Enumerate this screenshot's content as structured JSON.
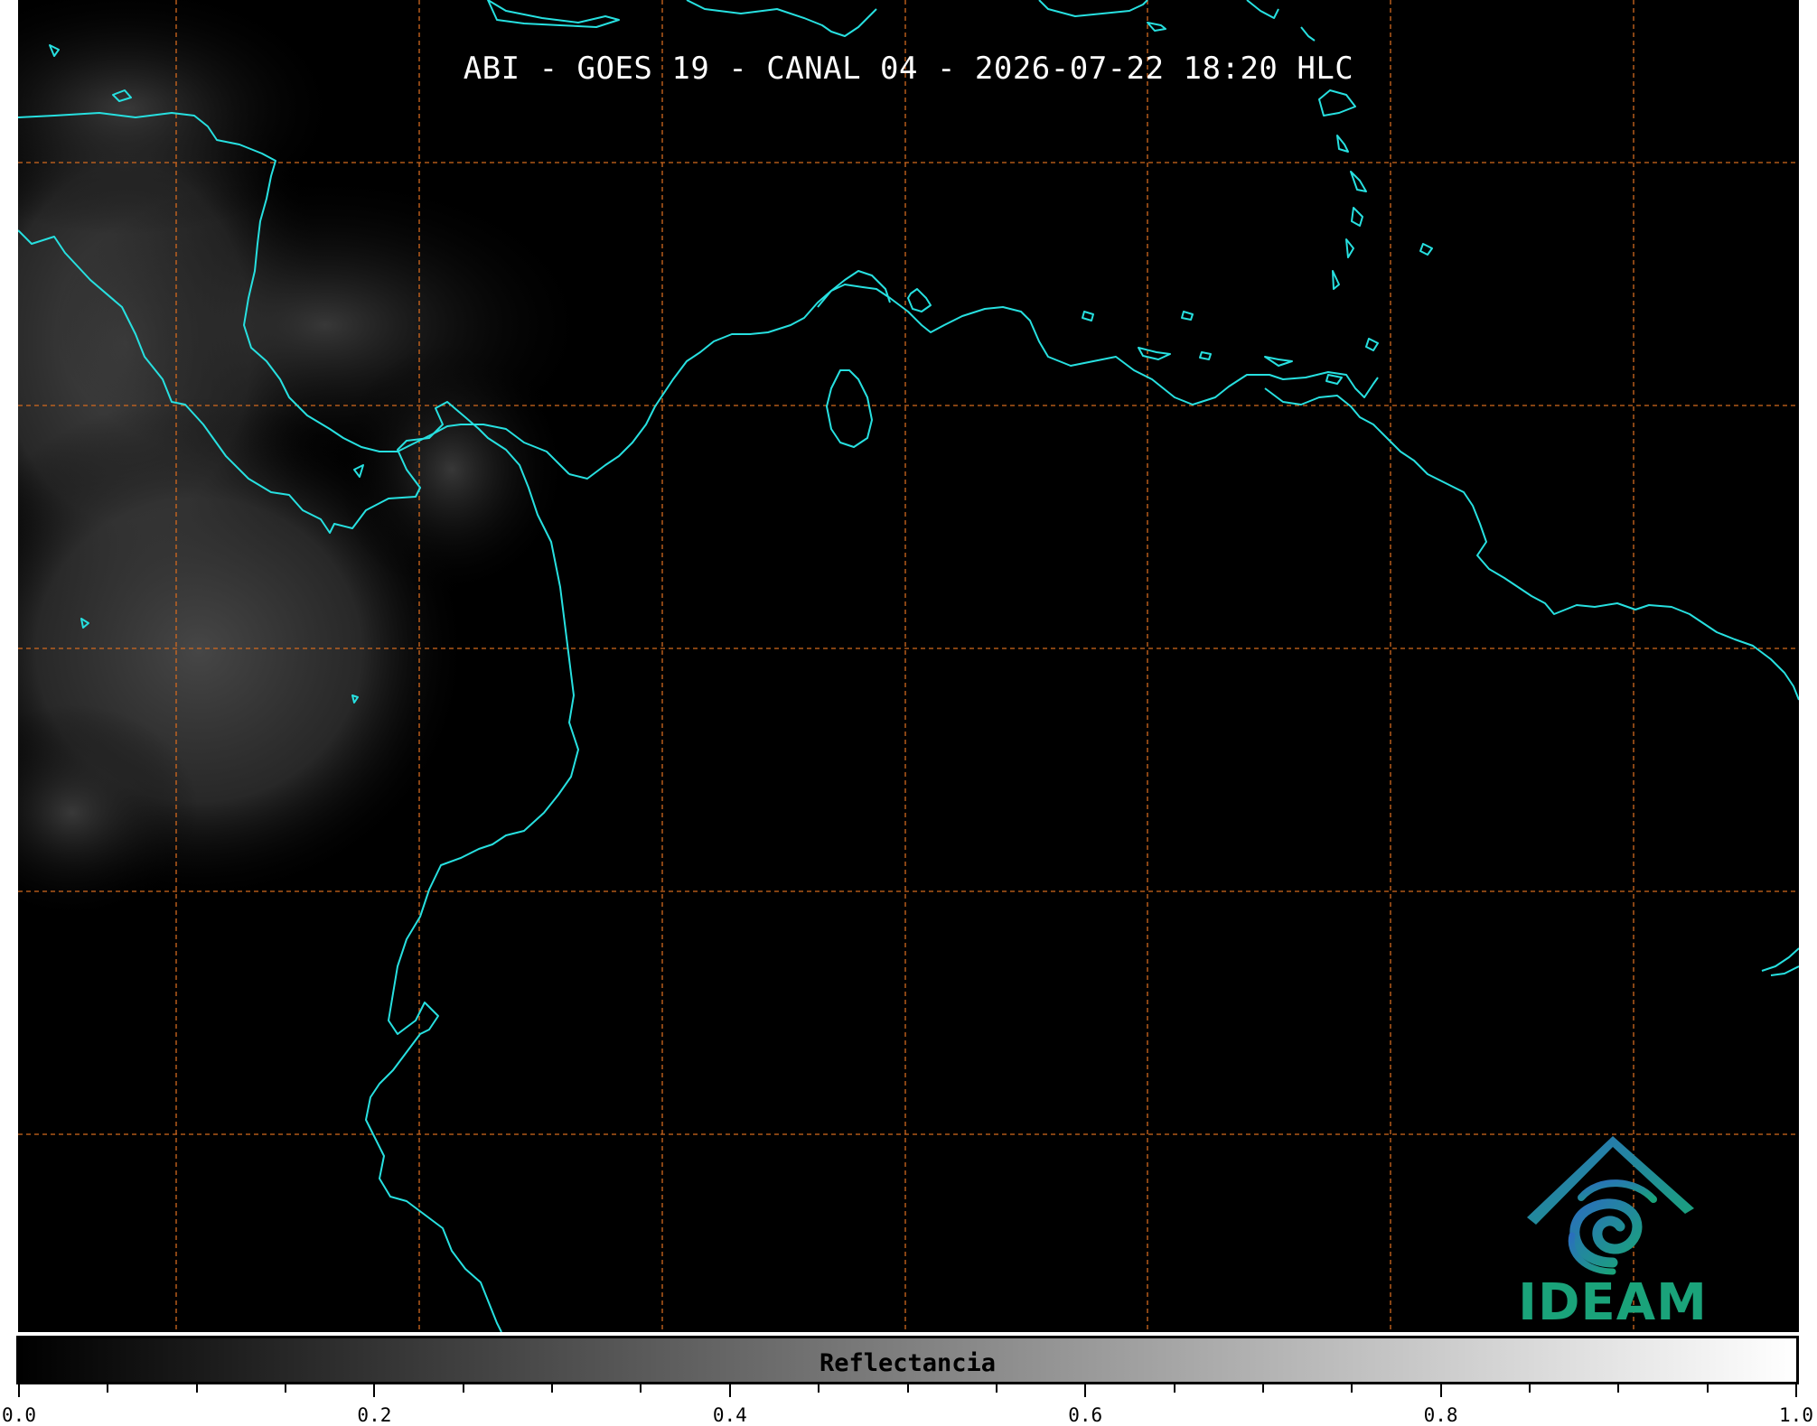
{
  "title": "ABI - GOES 19 - CANAL 04 - 2026-07-22 18:20 HLC",
  "colors": {
    "coastline": "#27e0e0",
    "gridline": "#d2691e",
    "background": "#000000",
    "logo_blue": "#2a7fb8",
    "logo_green": "#1aa37a"
  },
  "logo": {
    "text": "IDEAM"
  },
  "colorbar": {
    "label": "Reflectancia",
    "range": [
      0.0,
      1.0
    ],
    "cmap": "grayscale (black to white)",
    "major_ticks": [
      "0.0",
      "0.2",
      "0.4",
      "0.6",
      "0.8",
      "1.0"
    ],
    "minor_tick_step": 0.05
  },
  "map": {
    "gridlines": "dashed",
    "cloud_region": "left side (Central America / Pacific)"
  }
}
